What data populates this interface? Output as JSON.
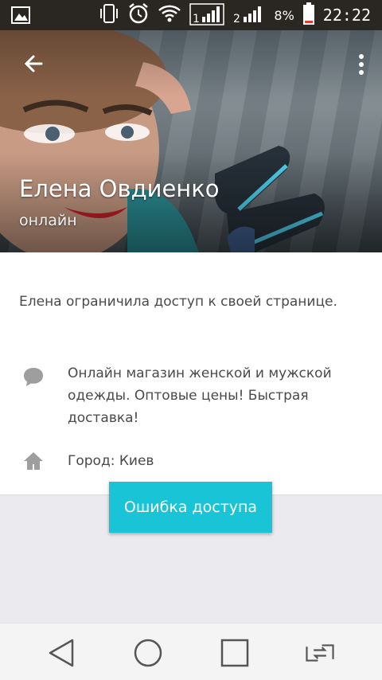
{
  "status_bar": {
    "battery_percent": "8%",
    "time": "22:22",
    "sim1": "1",
    "sim2": "2",
    "icons": [
      "gallery-icon",
      "phone-vibrate-icon",
      "alarm-icon",
      "wifi-icon",
      "signal-sim1-icon",
      "signal-sim2-icon",
      "battery-icon"
    ]
  },
  "profile": {
    "name": "Елена Овдиенко",
    "status": "онлайн"
  },
  "content": {
    "restricted_text": "Елена ограничила доступ к своей странице.",
    "about_text": "Онлайн магазин женской и мужской одежды. Оптовые цены! Быстрая доставка!",
    "city_text": "Город: Киев"
  },
  "toast": {
    "message": "Ошибка доступа"
  },
  "colors": {
    "accent": "#19c4d6",
    "statusbar": "#2a2622",
    "battery_low": "#e53935"
  }
}
